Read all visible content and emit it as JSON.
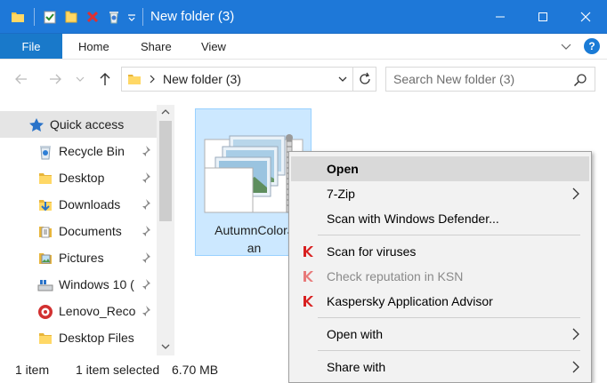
{
  "window": {
    "title": "New folder (3)",
    "minimize_icon": "minimize-icon",
    "maximize_icon": "maximize-icon",
    "close_icon": "close-icon"
  },
  "quick_access_toolbar": {
    "icons": [
      "folder-icon",
      "properties-icon",
      "new-folder-icon",
      "delete-icon",
      "recycle-icon",
      "customize-dropdown-icon"
    ]
  },
  "ribbon": {
    "tabs": [
      "File",
      "Home",
      "Share",
      "View"
    ],
    "help_label": "?",
    "colors": {
      "file_tab": "#1979ca",
      "title_bar": "#1e78d8"
    }
  },
  "address_bar": {
    "path": "New folder (3)",
    "search_placeholder": "Search New folder (3)"
  },
  "nav_pane": {
    "items": [
      {
        "label": "Quick access",
        "icon": "star-icon",
        "pinned": false,
        "selected": true
      },
      {
        "label": "Recycle Bin",
        "icon": "recycle-bin-icon",
        "pinned": true
      },
      {
        "label": "Desktop",
        "icon": "folder-icon",
        "pinned": true
      },
      {
        "label": "Downloads",
        "icon": "downloads-icon",
        "pinned": true
      },
      {
        "label": "Documents",
        "icon": "documents-icon",
        "pinned": true
      },
      {
        "label": "Pictures",
        "icon": "pictures-icon",
        "pinned": true
      },
      {
        "label": "Windows 10 (",
        "icon": "drive-icon",
        "pinned": true
      },
      {
        "label": "Lenovo_Reco",
        "icon": "lenovo-drive-icon",
        "pinned": true
      },
      {
        "label": "Desktop Files",
        "icon": "folder-icon",
        "pinned": false
      }
    ]
  },
  "files": [
    {
      "name_line1": "AutumnColorJ",
      "name_line2": "an",
      "selected": true,
      "icon": "zip-archive-icon"
    }
  ],
  "status_bar": {
    "item_count": "1 item",
    "selection": "1 item selected",
    "size": "6.70 MB"
  },
  "context_menu": {
    "items": [
      {
        "label": "Open",
        "bold": true,
        "highlighted": true
      },
      {
        "label": "7-Zip",
        "submenu": true
      },
      {
        "label": "Scan with Windows Defender..."
      },
      {
        "label": "Scan for viruses",
        "icon": "kaspersky-icon"
      },
      {
        "label": "Check reputation in KSN",
        "icon": "kaspersky-icon",
        "disabled": true
      },
      {
        "label": "Kaspersky Application Advisor",
        "icon": "kaspersky-icon"
      },
      {
        "label": "Open with",
        "submenu": true
      },
      {
        "label": "Share with",
        "submenu": true
      }
    ]
  }
}
